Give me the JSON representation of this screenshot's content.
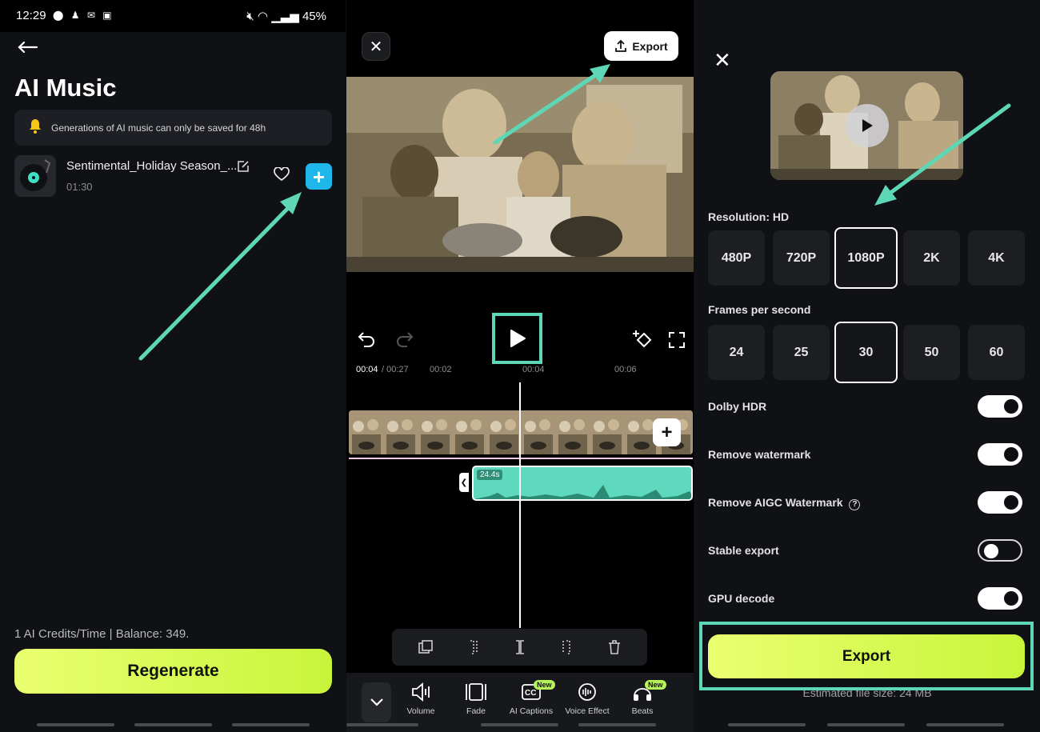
{
  "status_bar": {
    "time": "12:29",
    "battery": "45%"
  },
  "ai_music": {
    "title": "AI Music",
    "notice": "Generations of AI music can only be saved for 48h",
    "song": {
      "name": "Sentimental_Holiday Season_...",
      "duration": "01:30"
    },
    "credits": "1 AI Credits/Time | Balance: 349.",
    "regenerate_label": "Regenerate"
  },
  "editor": {
    "export_label": "Export",
    "timeline": {
      "current": "00:04",
      "total": "/ 00:27",
      "ticks": [
        "00:02",
        "00:04",
        "00:06"
      ]
    },
    "audio_clip_duration": "24.4s",
    "tools": [
      {
        "label": "Volume",
        "icon": "volume-icon"
      },
      {
        "label": "Fade",
        "icon": "fade-icon"
      },
      {
        "label": "AI Captions",
        "icon": "captions-icon",
        "badge": "New"
      },
      {
        "label": "Voice Effect",
        "icon": "voice-effect-icon"
      },
      {
        "label": "Beats",
        "icon": "beats-icon",
        "badge": "New"
      }
    ]
  },
  "export_settings": {
    "resolution_label": "Resolution: HD",
    "resolutions": [
      "480P",
      "720P",
      "1080P",
      "2K",
      "4K"
    ],
    "resolution_selected": "1080P",
    "fps_label": "Frames per second",
    "fps_options": [
      "24",
      "25",
      "30",
      "50",
      "60"
    ],
    "fps_selected": "30",
    "toggles": [
      {
        "label": "Dolby HDR",
        "on": true
      },
      {
        "label": "Remove watermark",
        "on": true
      },
      {
        "label": "Remove AIGC Watermark",
        "on": true
      },
      {
        "label": "Stable export",
        "on": false
      },
      {
        "label": "GPU decode",
        "on": true
      }
    ],
    "export_label": "Export",
    "file_size": "Estimated file size: 24 MB"
  },
  "colors": {
    "accent_teal": "#5dd7b5",
    "button_lime": "#d4f84a",
    "plus_blue": "#1fb6ea"
  }
}
